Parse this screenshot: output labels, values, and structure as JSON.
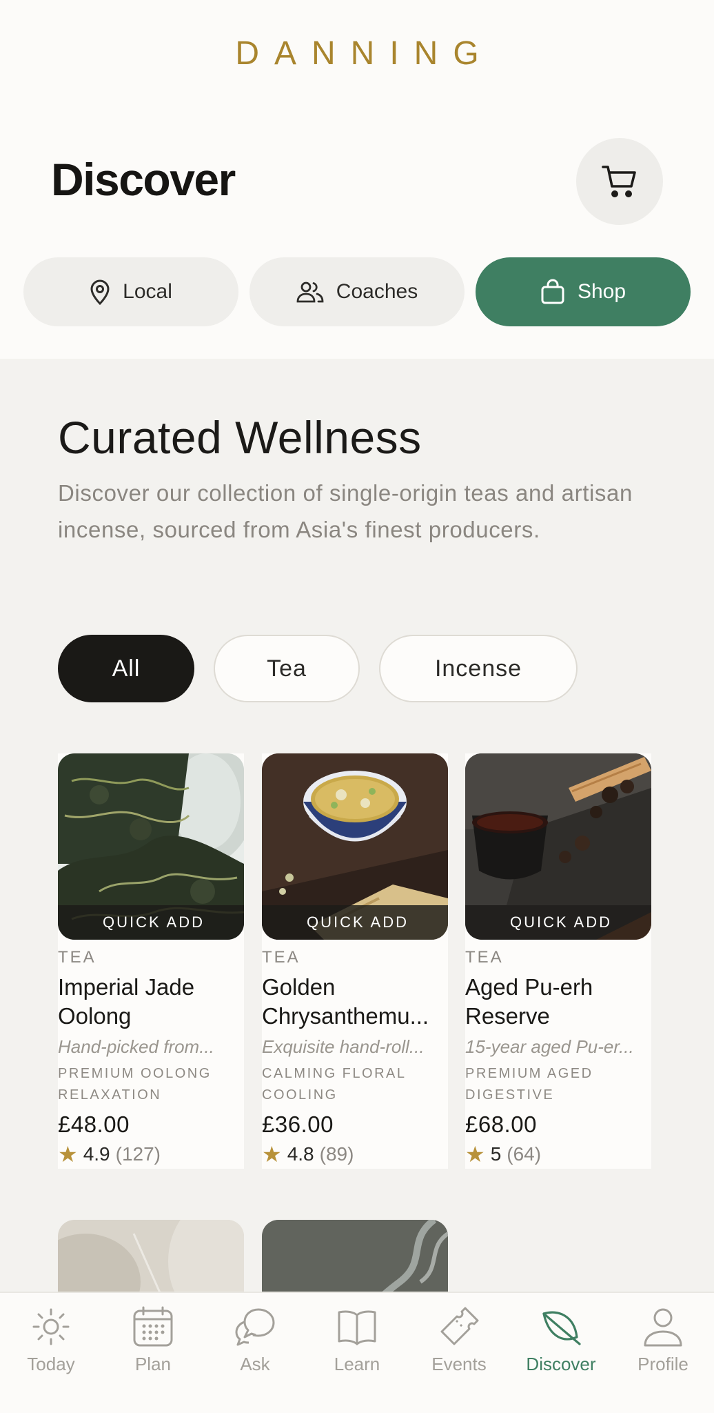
{
  "brand": "DANNING",
  "header": {
    "title": "Discover",
    "cart_icon": "cart-icon"
  },
  "segments": [
    {
      "label": "Local",
      "icon": "map-pin-icon",
      "active": false
    },
    {
      "label": "Coaches",
      "icon": "users-icon",
      "active": false
    },
    {
      "label": "Shop",
      "icon": "shopping-bag-icon",
      "active": true
    }
  ],
  "hero": {
    "title": "Curated Wellness",
    "subtitle": "Discover our collection of single-origin teas and artisan incense, sourced from Asia's finest producers."
  },
  "filters": [
    {
      "label": "All",
      "active": true
    },
    {
      "label": "Tea",
      "active": false
    },
    {
      "label": "Incense",
      "active": false
    }
  ],
  "quick_add_label": "QUICK ADD",
  "products": [
    {
      "category": "TEA",
      "name_line1": "Imperial Jade",
      "name_line2": "Oolong",
      "description": "Hand-picked from...",
      "tag1": "PREMIUM OOLONG",
      "tag2": "RELAXATION",
      "price": "£48.00",
      "rating": "4.9",
      "reviews": "(127)"
    },
    {
      "category": "TEA",
      "name_line1": "Golden",
      "name_line2": "Chrysanthemu...",
      "description": "Exquisite hand-roll...",
      "tag1": "CALMING FLORAL",
      "tag2": "COOLING",
      "price": "£36.00",
      "rating": "4.8",
      "reviews": "(89)"
    },
    {
      "category": "TEA",
      "name_line1": "Aged Pu-erh",
      "name_line2": "Reserve",
      "description": "15-year aged Pu-er...",
      "tag1": "PREMIUM AGED",
      "tag2": "DIGESTIVE",
      "price": "£68.00",
      "rating": "5",
      "reviews": "(64)"
    }
  ],
  "tabbar": [
    {
      "label": "Today",
      "icon": "sun-icon",
      "active": false
    },
    {
      "label": "Plan",
      "icon": "calendar-icon",
      "active": false
    },
    {
      "label": "Ask",
      "icon": "chat-icon",
      "active": false
    },
    {
      "label": "Learn",
      "icon": "book-icon",
      "active": false
    },
    {
      "label": "Events",
      "icon": "ticket-icon",
      "active": false
    },
    {
      "label": "Discover",
      "icon": "leaf-icon",
      "active": true
    },
    {
      "label": "Profile",
      "icon": "person-icon",
      "active": false
    }
  ],
  "colors": {
    "accent_green": "#3f7f62",
    "brand_gold": "#a9852e",
    "star_gold": "#b8923a"
  }
}
